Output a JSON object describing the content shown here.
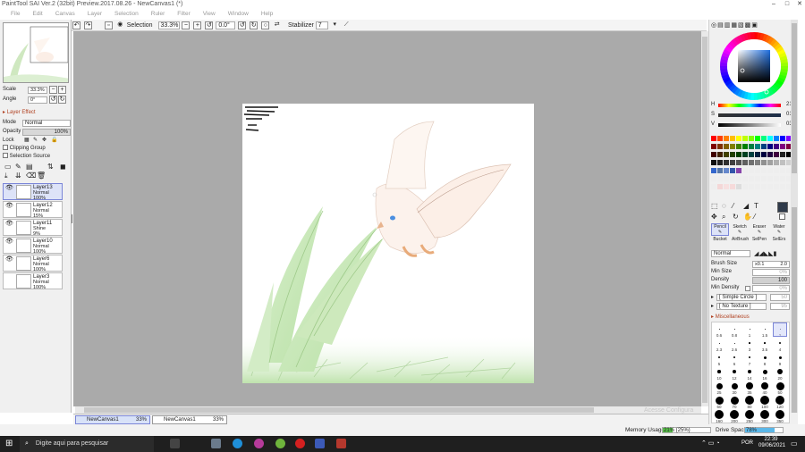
{
  "window": {
    "title": "PaintTool SAI Ver.2 (32bit) Preview.2017.08.26 - NewCanvas1 (*)"
  },
  "menu": [
    "File",
    "Edit",
    "Canvas",
    "Layer",
    "Selection",
    "Ruler",
    "Filter",
    "View",
    "Window",
    "Help"
  ],
  "toolbar": {
    "selection_label": "Selection",
    "zoom": "33.3%",
    "rotation": "0.0°",
    "stabilizer_label": "Stabilizer",
    "stabilizer_value": "7"
  },
  "navigator": {
    "scale_label": "Scale",
    "scale_value": "33.3%",
    "angle_label": "Angle",
    "angle_value": "0°"
  },
  "layer_panel": {
    "effect_header": "Layer Effect",
    "mode_label": "Mode",
    "mode_value": "Normal",
    "opacity_label": "Opacity",
    "opacity_value": "100%",
    "lock_label": "Lock",
    "clipping_label": "Clipping Group",
    "selection_source_label": "Selection Source",
    "layers": [
      {
        "name": "Layer13",
        "mode": "Normal",
        "opacity": "100%",
        "selected": true
      },
      {
        "name": "Layer12",
        "mode": "Normal",
        "opacity": "15%",
        "selected": false
      },
      {
        "name": "Layer11",
        "mode": "Shine",
        "opacity": "9%",
        "selected": false
      },
      {
        "name": "Layer10",
        "mode": "Normal",
        "opacity": "100%",
        "selected": false
      },
      {
        "name": "Layer6",
        "mode": "Normal",
        "opacity": "100%",
        "selected": false
      },
      {
        "name": "Layer3",
        "mode": "Normal",
        "opacity": "100%",
        "selected": false
      }
    ]
  },
  "color": {
    "h_label": "H",
    "h_value": "213",
    "s_label": "S",
    "s_value": "016",
    "v_label": "V",
    "v_value": "036",
    "current": "#2f3a4a"
  },
  "tools": {
    "row1": [
      "Pencil",
      "Sketch",
      "Eraser",
      "Water"
    ],
    "row2": [
      "Bucket",
      "AirBrush",
      "SelPen",
      "SelErs"
    ],
    "mode_value": "Normal",
    "brush_size_label": "Brush Size",
    "brush_size_mult": "x0.1",
    "brush_size_value": "2.0",
    "min_size_label": "Min Size",
    "min_size_value": "0%",
    "density_label": "Density",
    "density_value": "100",
    "min_density_label": "Min Density",
    "min_density_value": "0%",
    "shape_value": "[ Simple Circle ]",
    "shape_strength": "50",
    "texture_value": "[ No Texture ]",
    "texture_strength": "95",
    "misc_header": "Miscellaneous",
    "sizes": [
      "0.6",
      "0.8",
      "1",
      "1.5",
      "2",
      "2.3",
      "2.6",
      "3",
      "3.5",
      "4",
      "5",
      "6",
      "7",
      "8",
      "9",
      "10",
      "12",
      "14",
      "16",
      "20",
      "25",
      "30",
      "35",
      "40",
      "50",
      "60",
      "70",
      "80",
      "100",
      "120",
      "160",
      "200",
      "250",
      "300",
      "350"
    ]
  },
  "doc_tabs": [
    {
      "name": "NewCanvas1",
      "zoom": "33%"
    },
    {
      "name": "NewCanvas1",
      "zoom": "33%"
    }
  ],
  "status": {
    "memory_label": "Memory Usage",
    "memory_value": "21% (25%)",
    "drive_label": "Drive Space",
    "drive_value": "78%",
    "watermark": "Acesse Configura"
  },
  "taskbar": {
    "search_placeholder": "Digite aqui para pesquisar",
    "lang": "POR",
    "time": "22:39",
    "date": "09/06/2021"
  }
}
